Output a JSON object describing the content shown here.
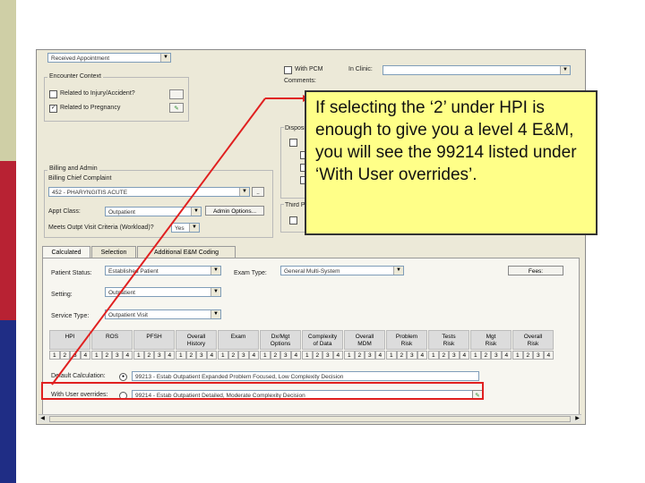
{
  "colors": {
    "band_top": "#cfcfa6",
    "band_mid": "#b82233",
    "band_bottom": "#1f2d85",
    "accent_red": "#e02020",
    "callout_bg": "#ffff88"
  },
  "top": {
    "left_field": "Received Appointment",
    "with_pcm": "With PCM",
    "in_clinic": "In Clinic:",
    "comments": "Comments:"
  },
  "encounter": {
    "title": "Encounter Context",
    "related_label": "Related to Injury/Accident?",
    "pregnant_label": "Related to Pregnancy",
    "pregnant_checked": "✓"
  },
  "disposition": {
    "title": "Disposition"
  },
  "billing": {
    "title": "Billing and Admin",
    "chief_label": "Billing Chief Complaint",
    "chief_value": "452 - PHARYNGITIS ACUTE",
    "appt_class_label": "Appt Class:",
    "appt_class_value": "Outpatient",
    "admin_options": "Admin Options...",
    "meets_label": "Meets Outpt Visit Criteria (Workload)?",
    "meets_value": "Yes"
  },
  "third": {
    "title": "Third Party"
  },
  "tabs": [
    "Calculated",
    "Selection",
    "Additional E&M Coding"
  ],
  "form": {
    "patient_status_label": "Patient Status:",
    "patient_status_value": "Established Patient",
    "exam_type_label": "Exam Type:",
    "exam_type_value": "General Multi-System",
    "fees_button": "Fees:",
    "setting_label": "Setting:",
    "setting_value": "Outpatient",
    "service_type_label": "Service Type:",
    "service_type_value": "Outpatient Visit"
  },
  "grid": {
    "headers": [
      {
        "l1": "HPI",
        "l2": ""
      },
      {
        "l1": "ROS",
        "l2": ""
      },
      {
        "l1": "PFSH",
        "l2": ""
      },
      {
        "l1": "Overall",
        "l2": "History"
      },
      {
        "l1": "Exam",
        "l2": ""
      },
      {
        "l1": "Dx/Mgt",
        "l2": "Options"
      },
      {
        "l1": "Complexity",
        "l2": "of Data"
      },
      {
        "l1": "Overall",
        "l2": "MDM"
      },
      {
        "l1": "Problem",
        "l2": "Risk"
      },
      {
        "l1": "Tests",
        "l2": "Risk"
      },
      {
        "l1": "Mgt",
        "l2": "Risk"
      },
      {
        "l1": "Overall",
        "l2": "Risk"
      }
    ],
    "values": [
      "1",
      "2",
      "3",
      "4"
    ]
  },
  "calc": {
    "default_label": "Default Calculation:",
    "default_value": "99213 - Estab Outpatient Expanded Problem Focused, Low Complexity Decision",
    "override_label": "With User overrides:",
    "override_value": "99214 - Estab Outpatient Detailed, Moderate Complexity Decision"
  },
  "callout": {
    "text": "If selecting the ‘2’ under HPI is enough to give you a level 4 E&M, you will see the 99214 listed under ‘With User overrides’."
  }
}
